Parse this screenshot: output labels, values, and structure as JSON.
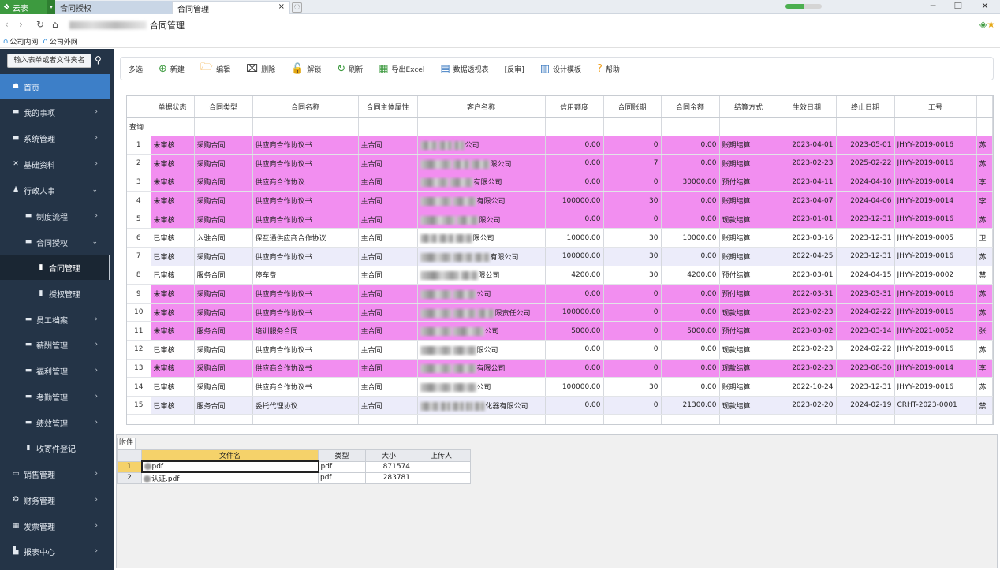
{
  "browser": {
    "app_name": "云表",
    "tabs": [
      "合同授权",
      "合同管理"
    ],
    "close_glyph": "×",
    "address_text": "合同管理",
    "window_controls": [
      "─",
      "❐",
      "✕"
    ],
    "progress": 0.5
  },
  "bookmarks": [
    "公司内网",
    "公司外网"
  ],
  "sidebar": {
    "search_placeholder": "输入表单或者文件夹名",
    "items": [
      {
        "label": "首页",
        "icon": "home-icon",
        "arrow": ""
      },
      {
        "label": "我的事项",
        "icon": "folder-icon",
        "arrow": "›"
      },
      {
        "label": "系统管理",
        "icon": "folder-icon",
        "arrow": "›"
      },
      {
        "label": "基础资料",
        "icon": "tools-icon",
        "arrow": "›"
      },
      {
        "label": "行政人事",
        "icon": "user-icon",
        "arrow": "⌄"
      },
      {
        "label": "制度流程",
        "icon": "folder-icon",
        "arrow": "›"
      },
      {
        "label": "合同授权",
        "icon": "folder-icon",
        "arrow": "⌄"
      },
      {
        "label": "合同管理",
        "icon": "doc-icon",
        "arrow": ""
      },
      {
        "label": "授权管理",
        "icon": "doc-icon",
        "arrow": ""
      },
      {
        "label": "员工档案",
        "icon": "folder-icon",
        "arrow": "›"
      },
      {
        "label": "薪酬管理",
        "icon": "folder-icon",
        "arrow": "›"
      },
      {
        "label": "福利管理",
        "icon": "folder-icon",
        "arrow": "›"
      },
      {
        "label": "考勤管理",
        "icon": "folder-icon",
        "arrow": "›"
      },
      {
        "label": "绩效管理",
        "icon": "folder-icon",
        "arrow": "›"
      },
      {
        "label": "收寄件登记",
        "icon": "doc-icon",
        "arrow": ""
      },
      {
        "label": "销售管理",
        "icon": "briefcase-icon",
        "arrow": "›"
      },
      {
        "label": "财务管理",
        "icon": "money-icon",
        "arrow": "›"
      },
      {
        "label": "发票管理",
        "icon": "grid-icon",
        "arrow": "›"
      },
      {
        "label": "报表中心",
        "icon": "chart-icon",
        "arrow": "›"
      }
    ]
  },
  "toolbar": {
    "items": [
      {
        "label": "多选",
        "icon": ""
      },
      {
        "label": "新建",
        "icon": "⊕"
      },
      {
        "label": "编辑",
        "icon": "🗁"
      },
      {
        "label": "删除",
        "icon": "⌧"
      },
      {
        "label": "解锁",
        "icon": "🔓"
      },
      {
        "label": "刷新",
        "icon": "↻"
      },
      {
        "label": "导出Excel",
        "icon": "▦"
      },
      {
        "label": "数据透视表",
        "icon": "▤"
      },
      {
        "label": "[反审]",
        "icon": ""
      },
      {
        "label": "设计模板",
        "icon": "▥"
      },
      {
        "label": "帮助",
        "icon": "?"
      }
    ]
  },
  "grid": {
    "columns": [
      "",
      "单据状态",
      "合同类型",
      "合同名称",
      "合同主体属性",
      "客户名称",
      "信用额度",
      "合同账期",
      "合同金额",
      "结算方式",
      "生效日期",
      "终止日期",
      "工号",
      ""
    ],
    "query_label": "查询",
    "rows": [
      {
        "n": "1",
        "status": "未审核",
        "type": "采购合同",
        "name": "供应商合作协议书",
        "subject": "主合同",
        "customer": "公司",
        "credit": "0.00",
        "period": "0",
        "amount": "0.00",
        "settle": "账期结算",
        "start": "2023-04-01",
        "end": "2023-05-01",
        "emp": "JHYY-2019-0016",
        "last": "苏",
        "style": "pink",
        "blur": [
          22,
          18,
          14
        ]
      },
      {
        "n": "2",
        "status": "未审核",
        "type": "采购合同",
        "name": "供应商合作协议书",
        "subject": "主合同",
        "customer": "限公司",
        "credit": "0.00",
        "period": "7",
        "amount": "0.00",
        "settle": "账期结算",
        "start": "2023-02-23",
        "end": "2025-02-22",
        "emp": "JHYY-2019-0016",
        "last": "苏",
        "style": "pink",
        "blur": [
          40,
          22,
          24
        ]
      },
      {
        "n": "3",
        "status": "未审核",
        "type": "采购合同",
        "name": "供应商合作协议",
        "subject": "主合同",
        "customer": "有限公司",
        "credit": "0.00",
        "period": "0",
        "amount": "30000.00",
        "settle": "预付结算",
        "start": "2023-04-11",
        "end": "2024-04-10",
        "emp": "JHYY-2019-0014",
        "last": "李",
        "style": "pink",
        "blur": [
          36,
          30
        ]
      },
      {
        "n": "4",
        "status": "未审核",
        "type": "采购合同",
        "name": "供应商合作协议书",
        "subject": "主合同",
        "customer": "有限公司",
        "credit": "100000.00",
        "period": "30",
        "amount": "0.00",
        "settle": "账期结算",
        "start": "2023-04-07",
        "end": "2024-04-06",
        "emp": "JHYY-2019-0014",
        "last": "李",
        "style": "pink",
        "blur": [
          40,
          30
        ]
      },
      {
        "n": "5",
        "status": "未审核",
        "type": "采购合同",
        "name": "供应商合作协议书",
        "subject": "主合同",
        "customer": "限公司",
        "credit": "0.00",
        "period": "0",
        "amount": "0.00",
        "settle": "现款结算",
        "start": "2023-01-01",
        "end": "2023-12-31",
        "emp": "JHYY-2019-0016",
        "last": "苏",
        "style": "pink",
        "blur": [
          45,
          28
        ]
      },
      {
        "n": "6",
        "status": "已审核",
        "type": "入驻合同",
        "name": "保互通供应商合作协议",
        "subject": "主合同",
        "customer": "限公司",
        "credit": "10000.00",
        "period": "30",
        "amount": "10000.00",
        "settle": "账期结算",
        "start": "2023-03-16",
        "end": "2023-12-31",
        "emp": "JHYY-2019-0005",
        "last": "卫",
        "style": "white",
        "blur": [
          22,
          20,
          22
        ]
      },
      {
        "n": "7",
        "status": "已审核",
        "type": "采购合同",
        "name": "供应商合作协议书",
        "subject": "主合同",
        "customer": "有限公司",
        "credit": "100000.00",
        "period": "30",
        "amount": "0.00",
        "settle": "账期结算",
        "start": "2022-04-25",
        "end": "2023-12-31",
        "emp": "JHYY-2019-0016",
        "last": "苏",
        "style": "lav",
        "blur": [
          40,
          26,
          20
        ]
      },
      {
        "n": "8",
        "status": "已审核",
        "type": "服务合同",
        "name": "停车费",
        "subject": "主合同",
        "customer": "限公司",
        "credit": "4200.00",
        "period": "30",
        "amount": "4200.00",
        "settle": "预付结算",
        "start": "2023-03-01",
        "end": "2024-04-15",
        "emp": "JHYY-2019-0002",
        "last": "禁",
        "style": "white",
        "blur": [
          50,
          22
        ]
      },
      {
        "n": "9",
        "status": "未审核",
        "type": "采购合同",
        "name": "供应商合作协议书",
        "subject": "主合同",
        "customer": "公司",
        "credit": "0.00",
        "period": "0",
        "amount": "0.00",
        "settle": "预付结算",
        "start": "2022-03-31",
        "end": "2023-03-31",
        "emp": "JHYY-2019-0016",
        "last": "苏",
        "style": "pink",
        "blur": [
          40,
          30
        ]
      },
      {
        "n": "10",
        "status": "未审核",
        "type": "采购合同",
        "name": "供应商合作协议书",
        "subject": "主合同",
        "customer": "限责任公司",
        "credit": "100000.00",
        "period": "0",
        "amount": "0.00",
        "settle": "现款结算",
        "start": "2023-02-23",
        "end": "2024-02-22",
        "emp": "JHYY-2019-0016",
        "last": "苏",
        "style": "pink",
        "blur": [
          40,
          30,
          22
        ]
      },
      {
        "n": "11",
        "status": "未审核",
        "type": "服务合同",
        "name": "培训服务合同",
        "subject": "主合同",
        "customer": "公司",
        "credit": "5000.00",
        "period": "0",
        "amount": "5000.00",
        "settle": "预付结算",
        "start": "2023-03-02",
        "end": "2023-03-14",
        "emp": "JHYY-2021-0052",
        "last": "张",
        "style": "pink",
        "blur": [
          40,
          40
        ]
      },
      {
        "n": "12",
        "status": "已审核",
        "type": "采购合同",
        "name": "供应商合作协议书",
        "subject": "主合同",
        "customer": "限公司",
        "credit": "0.00",
        "period": "0",
        "amount": "0.00",
        "settle": "现款结算",
        "start": "2023-02-23",
        "end": "2024-02-22",
        "emp": "JHYY-2019-0016",
        "last": "苏",
        "style": "white",
        "blur": [
          40,
          30
        ]
      },
      {
        "n": "13",
        "status": "未审核",
        "type": "采购合同",
        "name": "供应商合作协议书",
        "subject": "主合同",
        "customer": "有限公司",
        "credit": "0.00",
        "period": "0",
        "amount": "0.00",
        "settle": "现款结算",
        "start": "2023-02-23",
        "end": "2023-08-30",
        "emp": "JHYY-2019-0014",
        "last": "李",
        "style": "pink",
        "blur": [
          40,
          30
        ]
      },
      {
        "n": "14",
        "status": "已审核",
        "type": "采购合同",
        "name": "供应商合作协议书",
        "subject": "主合同",
        "customer": "公司",
        "credit": "100000.00",
        "period": "30",
        "amount": "0.00",
        "settle": "账期结算",
        "start": "2022-10-24",
        "end": "2023-12-31",
        "emp": "JHYY-2019-0016",
        "last": "苏",
        "style": "white",
        "blur": [
          40,
          30
        ]
      },
      {
        "n": "15",
        "status": "已审核",
        "type": "服务合同",
        "name": "委托代理协议",
        "subject": "主合同",
        "customer": "化器有限公司",
        "credit": "0.00",
        "period": "0",
        "amount": "21300.00",
        "settle": "现款结算",
        "start": "2023-02-20",
        "end": "2024-02-19",
        "emp": "CRHT-2023-0001",
        "last": "禁",
        "style": "lav",
        "blur": [
          24,
          14,
          16,
          10,
          14
        ]
      }
    ]
  },
  "attachments": {
    "tab_label": "附件",
    "columns": [
      "",
      "文件名",
      "类型",
      "大小",
      "上传人"
    ],
    "rows": [
      {
        "n": "1",
        "name": "pdf",
        "type": "pdf",
        "size": "871574",
        "uploader": ""
      },
      {
        "n": "2",
        "name": "认证.pdf",
        "type": "pdf",
        "size": "283781",
        "uploader": ""
      }
    ]
  },
  "colors": {
    "pink_row": "#f28ef0",
    "lavender_row": "#ececfa",
    "sidebar_bg": "#243447",
    "sidebar_active": "#3d7fc8",
    "app_green": "#3d9a3f"
  }
}
